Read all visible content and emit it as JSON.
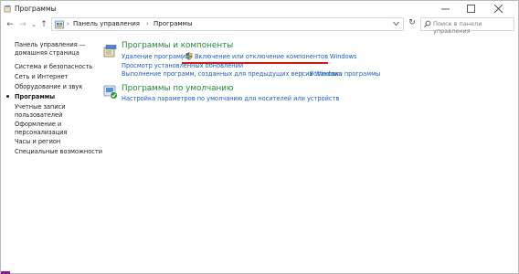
{
  "window": {
    "title": "Программы",
    "controls": {
      "minimize": "—",
      "maximize": "☐",
      "close": "✕"
    }
  },
  "nav": {
    "back": "←",
    "forward": "→",
    "recent": "⌄",
    "up": "↑",
    "breadcrumb": [
      "Панель управления",
      "Программы"
    ],
    "separator": "›",
    "refresh": "↻",
    "search_placeholder": "Поиск в панели управления"
  },
  "sidebar": {
    "home_line1": "Панель управления —",
    "home_line2": "домашняя страница",
    "items": [
      "Система и безопасность",
      "Сеть и Интернет",
      "Оборудование и звук",
      "Программы",
      "Учетные записи",
      "пользователей",
      "Оформление и",
      "персонализация",
      "Часы и регион",
      "Специальные возможности"
    ],
    "active_index": 3
  },
  "main": {
    "programs": {
      "title": "Программы и компоненты",
      "links": {
        "uninstall": "Удаление программы",
        "toggle_features": "Включение или отключение компонентов Windows",
        "view_updates": "Просмотр установленных обновлений",
        "run_old": "Выполнение программ, созданных для предыдущих версий Windows",
        "how_install": "Установка программы"
      }
    },
    "defaults": {
      "title": "Программы по умолчанию",
      "links": {
        "media_defaults": "Настройка параметров по умолчанию для носителей или устройств"
      }
    }
  },
  "colors": {
    "category_title": "#1e8a3a",
    "link": "#1b5dbb",
    "highlight_underline": "#d11616"
  }
}
